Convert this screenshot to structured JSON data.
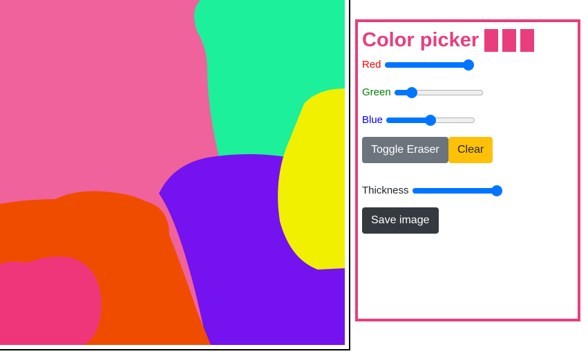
{
  "panel": {
    "title": "Color picker",
    "accent_color": "#e83e7d",
    "swatch_count": 3,
    "controls": {
      "red": {
        "label": "Red",
        "label_color": "#ff0000",
        "value": 0.95
      },
      "green": {
        "label": "Green",
        "label_color": "#008000",
        "value": 0.2
      },
      "blue": {
        "label": "Blue",
        "label_color": "#0000ff",
        "value": 0.5
      },
      "thickness": {
        "label": "Thickness",
        "label_color": "#212529",
        "value": 0.96
      }
    },
    "buttons": {
      "toggle_eraser": "Toggle Eraser",
      "clear": "Clear",
      "save_image": "Save image"
    }
  },
  "canvas": {
    "blob_colors": {
      "pink": "#f0629b",
      "green": "#1cf09a",
      "yellow": "#f0f000",
      "purple": "#7412f0",
      "orange": "#f04c00",
      "magenta": "#f0367a"
    }
  }
}
